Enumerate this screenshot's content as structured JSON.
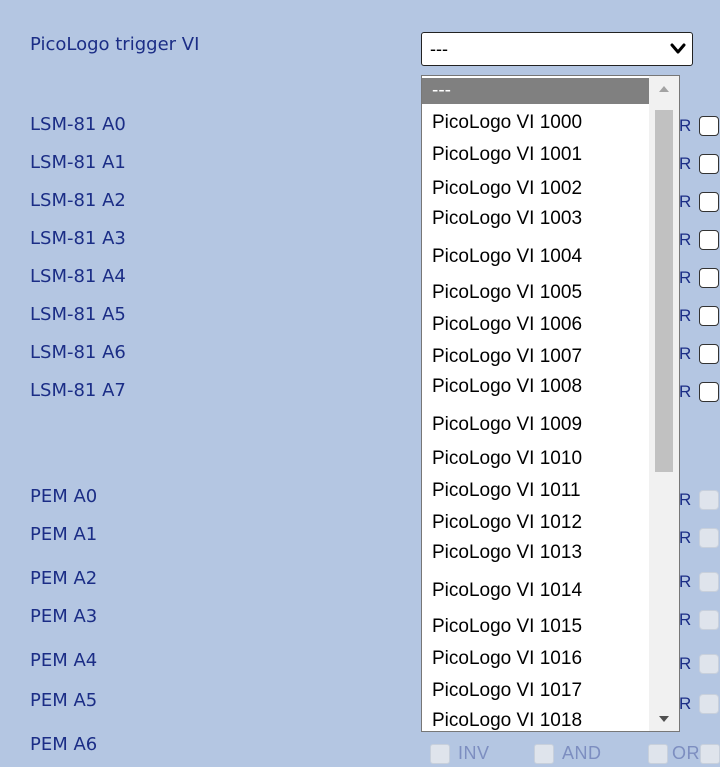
{
  "trigger": {
    "label": "PicoLogo trigger VI",
    "selected_value": "---"
  },
  "lsm_rows": [
    "LSM-81 A0",
    "LSM-81 A1",
    "LSM-81 A2",
    "LSM-81 A3",
    "LSM-81 A4",
    "LSM-81 A5",
    "LSM-81 A6",
    "LSM-81 A7"
  ],
  "pem_rows": [
    "PEM A0",
    "PEM A1",
    "PEM A2",
    "PEM A3",
    "PEM A4",
    "PEM A5",
    "PEM A6"
  ],
  "row_fragment": "R",
  "dropdown_options": [
    "---",
    "PicoLogo VI 1000",
    "PicoLogo VI 1001",
    "PicoLogo VI 1002",
    "PicoLogo VI 1003",
    "PicoLogo VI 1004",
    "PicoLogo VI 1005",
    "PicoLogo VI 1006",
    "PicoLogo VI 1007",
    "PicoLogo VI 1008",
    "PicoLogo VI 1009",
    "PicoLogo VI 1010",
    "PicoLogo VI 1011",
    "PicoLogo VI 1012",
    "PicoLogo VI 1013",
    "PicoLogo VI 1014",
    "PicoLogo VI 1015",
    "PicoLogo VI 1016",
    "PicoLogo VI 1017",
    "PicoLogo VI 1018"
  ],
  "bottom_options": {
    "inv": "INV",
    "and": "AND",
    "or": "OR"
  },
  "colors": {
    "background": "#b4c6e2",
    "label_text": "#1b2d86",
    "selected_option": "#808080"
  },
  "icons": {
    "select_arrow": "chevron-down-icon",
    "scroll_up": "triangle-up-icon",
    "scroll_down": "triangle-down-icon"
  }
}
